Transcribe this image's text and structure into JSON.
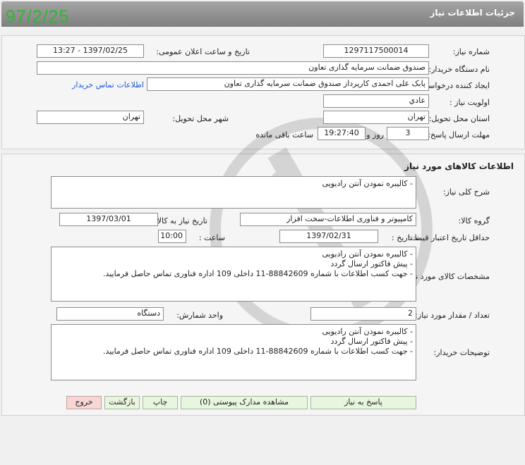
{
  "header": {
    "title": "جزئیات اطلاعات نیاز",
    "date_stamp": "97/2/25"
  },
  "details": {
    "need_number_label": "شماره نیاز:",
    "need_number": "1297117500014",
    "announce_label": "تاریخ و ساعت اعلان عمومی:",
    "announce_value": "1397/02/25 - 13:27",
    "buyer_org_label": "نام دستگاه خریدار:",
    "buyer_org": "صندوق ضمانت سرمایه گذاری تعاون",
    "creator_label": "ایجاد کننده درخواست:",
    "creator": "پابک علی احمدی کارپرداز صندوق ضمانت سرمایه گذاری تعاون",
    "contact_link": "اطلاعات تماس خریدار",
    "priority_label": "اولویت نیاز :",
    "priority": "عادي",
    "province_label": "استان محل تحویل:",
    "province": "تهران",
    "city_label": "شهر محل تحویل:",
    "city": "تهران",
    "deadline_label": "مهلت ارسال پاسخ:",
    "deadline_days": "3",
    "days_and": "روز و",
    "deadline_time": "19:27:40",
    "remaining": "ساعت باقی مانده"
  },
  "goods": {
    "section_title": "اطلاعات کالاهای مورد نیاز",
    "summary_label": "شرح کلی نیاز:",
    "summary": "- کالیبره نمودن آنتن رادیویی",
    "group_label": "گروه کالا:",
    "group": "کامپیوتر و فناوری اطلاعات-سخت افزار",
    "need_date_label": "تاریخ نیاز به کالا:",
    "need_date": "1397/03/01",
    "validity_label": "حداقل تاریخ اعتبار قیمت:",
    "until_date_label": "تا تاریخ :",
    "until_date": "1397/02/31",
    "time_label": "ساعت :",
    "time": "10:00",
    "specs_label": "مشخصات کالای مورد نیاز:",
    "specs": [
      "- کالیبره نمودن آنتن رادیویی",
      "- پیش فاکتور ارسال گردد",
      "- جهت کسب اطلاعات با شماره 88842609-11 داخلی 109 اداره فناوری تماس حاصل فرمایید."
    ],
    "quantity_label": "تعداد / مقدار مورد نیاز:",
    "quantity": "2",
    "unit_label": "واحد شمارش:",
    "unit": "دستگاه",
    "notes_label": "توضیحات خریدار:",
    "notes": [
      "- کالیبره نمودن آنتن رادیویی",
      "- پیش فاکتور ارسال گردد",
      "- جهت کسب اطلاعات با شماره 88842609-11 داخلی 109 اداره فناوری تماس حاصل فرمایید."
    ]
  },
  "buttons": {
    "reply": "پاسخ به نیاز",
    "attachments": "مشاهده مدارک پیوستی (0)",
    "print": "چاپ",
    "back": "بازگشت",
    "exit": "خروج"
  }
}
